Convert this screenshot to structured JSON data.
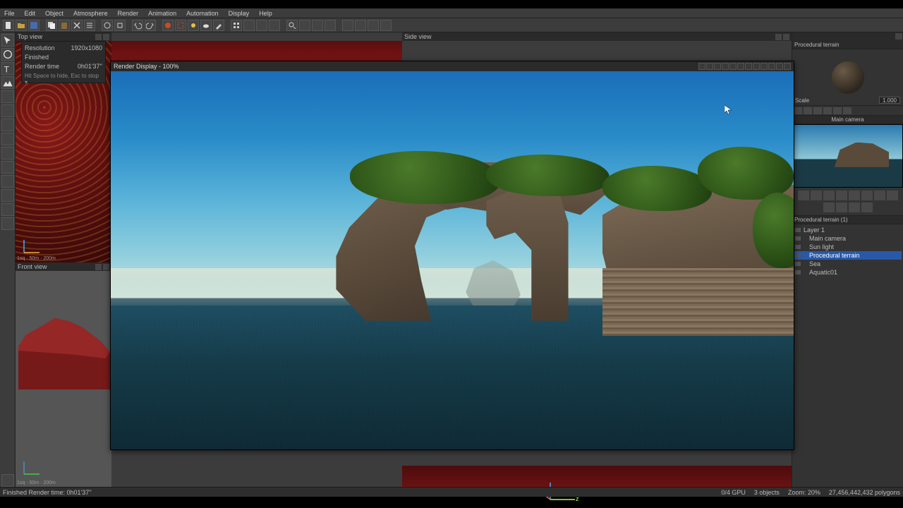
{
  "menu": {
    "items": [
      "File",
      "Edit",
      "Object",
      "Atmosphere",
      "Render",
      "Animation",
      "Automation",
      "Display",
      "Help"
    ]
  },
  "viewports": {
    "top_label": "Top view",
    "front_label": "Front view",
    "side_label": "Side view",
    "scale_text_top": "1sq · 50m · 200m",
    "scale_text_front": "1sq · 50m · 200m"
  },
  "info": {
    "resolution_label": "Resolution",
    "resolution_value": "1920x1080",
    "status": "Finished",
    "time_label": "Render time",
    "time_value": "0h01'37''",
    "hint": "Hit Space to hide, Esc to stop ▾"
  },
  "render": {
    "title": "Render Display - 100%"
  },
  "right": {
    "mat_title": "Procedural terrain",
    "scale_label": "Scale",
    "scale_value": "1.000",
    "cam_title": "Main camera",
    "layer_title": "Procedural terrain (1)",
    "tree": [
      {
        "label": "Layer 1",
        "sel": false
      },
      {
        "label": "Main camera",
        "sel": false
      },
      {
        "label": "Sun light",
        "sel": false
      },
      {
        "label": "Procedural terrain",
        "sel": true
      },
      {
        "label": "Sea",
        "sel": false
      },
      {
        "label": "Aquatic01",
        "sel": false
      }
    ]
  },
  "status": {
    "left": "Finished Render time: 0h01'37''",
    "gpu": "0/4 GPU",
    "objects": "3 objects",
    "zoom": "Zoom: 20%",
    "polys": "27,456,442,432 polygons"
  }
}
